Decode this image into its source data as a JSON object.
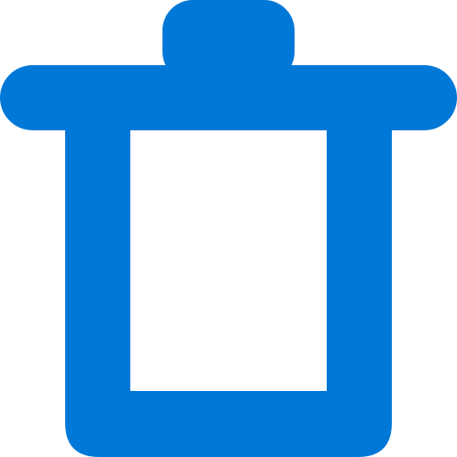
{
  "icon": {
    "name": "trash-icon",
    "color": "#0078D7",
    "background": "#FFFFFF"
  }
}
